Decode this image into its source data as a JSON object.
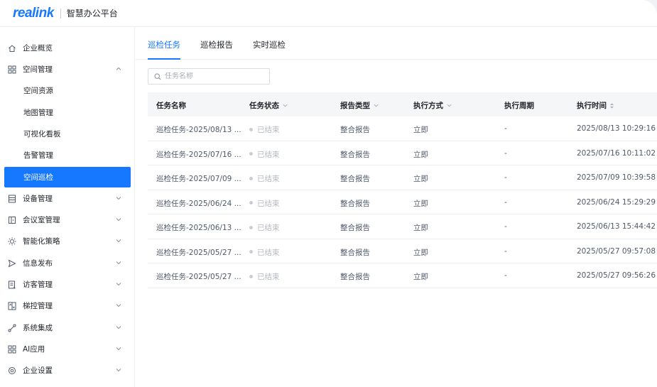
{
  "header": {
    "logo": "realink",
    "platform": "智慧办公平台"
  },
  "sidebar": {
    "items": [
      {
        "label": "企业概览",
        "icon": "home-icon",
        "expandable": false
      },
      {
        "label": "空间管理",
        "icon": "grid-icon",
        "expandable": true,
        "expanded": true
      },
      {
        "label": "空间资源",
        "sub": true
      },
      {
        "label": "地图管理",
        "sub": true
      },
      {
        "label": "可视化看板",
        "sub": true
      },
      {
        "label": "告警管理",
        "sub": true
      },
      {
        "label": "空间巡检",
        "sub": true,
        "active": true
      },
      {
        "label": "设备管理",
        "icon": "device-icon",
        "expandable": true
      },
      {
        "label": "会议室管理",
        "icon": "meeting-room-icon",
        "expandable": true
      },
      {
        "label": "智能化策略",
        "icon": "strategy-icon",
        "expandable": true
      },
      {
        "label": "信息发布",
        "icon": "send-icon",
        "expandable": true
      },
      {
        "label": "访客管理",
        "icon": "visitor-icon",
        "expandable": true
      },
      {
        "label": "梯控管理",
        "icon": "elevator-icon",
        "expandable": true
      },
      {
        "label": "系统集成",
        "icon": "integration-icon",
        "expandable": true
      },
      {
        "label": "AI应用",
        "icon": "ai-app-icon",
        "expandable": true
      },
      {
        "label": "企业设置",
        "icon": "gear-icon",
        "expandable": true
      }
    ]
  },
  "tabs": [
    {
      "label": "巡检任务",
      "active": true
    },
    {
      "label": "巡检报告",
      "active": false
    },
    {
      "label": "实时巡检",
      "active": false
    }
  ],
  "search": {
    "placeholder": "任务名称"
  },
  "table": {
    "columns": [
      "任务名称",
      "任务状态",
      "报告类型",
      "执行方式",
      "执行周期",
      "执行时间"
    ],
    "rows": [
      [
        "巡检任务-2025/08/13 ...",
        "已结束",
        "整合报告",
        "立即",
        "-",
        "2025/08/13 10:29:16"
      ],
      [
        "巡检任务-2025/07/16 ...",
        "已结束",
        "整合报告",
        "立即",
        "-",
        "2025/07/16 10:11:02"
      ],
      [
        "巡检任务-2025/07/09 ...",
        "已结束",
        "整合报告",
        "立即",
        "-",
        "2025/07/09 10:39:58"
      ],
      [
        "巡检任务-2025/06/24 ...",
        "已结束",
        "整合报告",
        "立即",
        "-",
        "2025/06/24 15:29:29"
      ],
      [
        "巡检任务-2025/06/13 ...",
        "已结束",
        "整合报告",
        "立即",
        "-",
        "2025/06/13 15:44:42"
      ],
      [
        "巡检任务-2025/05/27 ...",
        "已结束",
        "整合报告",
        "立即",
        "-",
        "2025/05/27 09:57:08"
      ],
      [
        "巡检任务-2025/05/27 ...",
        "已结束",
        "整合报告",
        "立即",
        "-",
        "2025/05/27 09:56:26"
      ]
    ]
  },
  "colors": {
    "accent": "#1677ff",
    "status_dot": "#c9cdd4"
  }
}
